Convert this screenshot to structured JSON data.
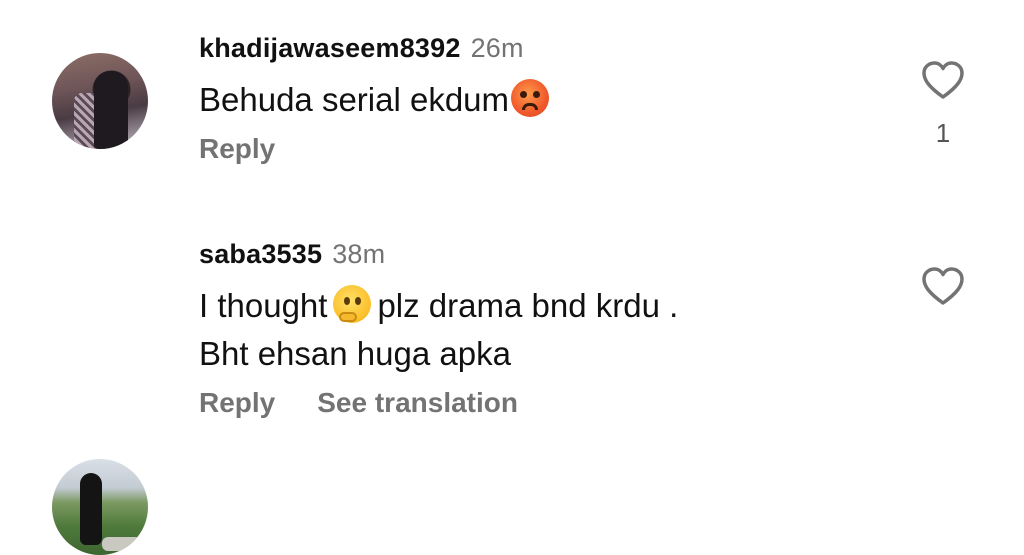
{
  "comments": [
    {
      "username": "khadijawaseem8392",
      "time": "26m",
      "text_before": "Behuda serial ekdum",
      "emoji": "angry-face",
      "text_after": "",
      "text_line2": "",
      "reply_label": "Reply",
      "like_icon": "heart-outline-icon",
      "like_count": "1"
    },
    {
      "username": "saba3535",
      "time": "38m",
      "text_before": "I thought",
      "emoji": "thinking-face",
      "text_after": "plz drama bnd krdu .",
      "text_line2": "Bht ehsan huga apka",
      "reply_label": "Reply",
      "translation_label": "See translation",
      "like_icon": "heart-outline-icon"
    }
  ],
  "colors": {
    "text": "#111111",
    "muted": "#737373",
    "background": "#ffffff"
  }
}
